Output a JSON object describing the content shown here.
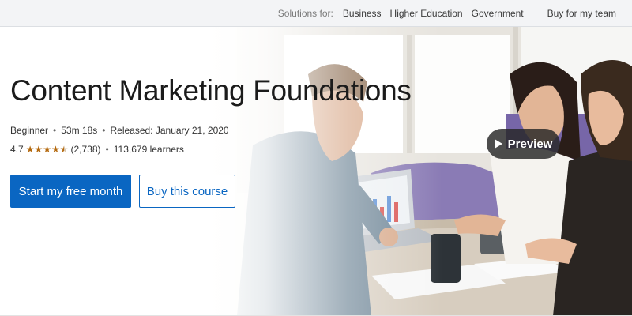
{
  "topbar": {
    "solutions_label": "Solutions for:",
    "links": [
      "Business",
      "Higher Education",
      "Government"
    ],
    "team_link": "Buy for my team"
  },
  "course": {
    "title": "Content Marketing Foundations",
    "level": "Beginner",
    "duration": "53m 18s",
    "released": "Released: January 21, 2020",
    "rating_value": "4.7",
    "rating_stars": 4.5,
    "rating_count": "(2,738)",
    "learners": "113,679 learners"
  },
  "actions": {
    "primary_label": "Start my free month",
    "secondary_label": "Buy this course",
    "preview_label": "Preview"
  },
  "colors": {
    "brand_blue": "#0a66c2",
    "star": "#b4690e"
  },
  "icons": {
    "play": "play-icon",
    "star": "star-icon"
  }
}
